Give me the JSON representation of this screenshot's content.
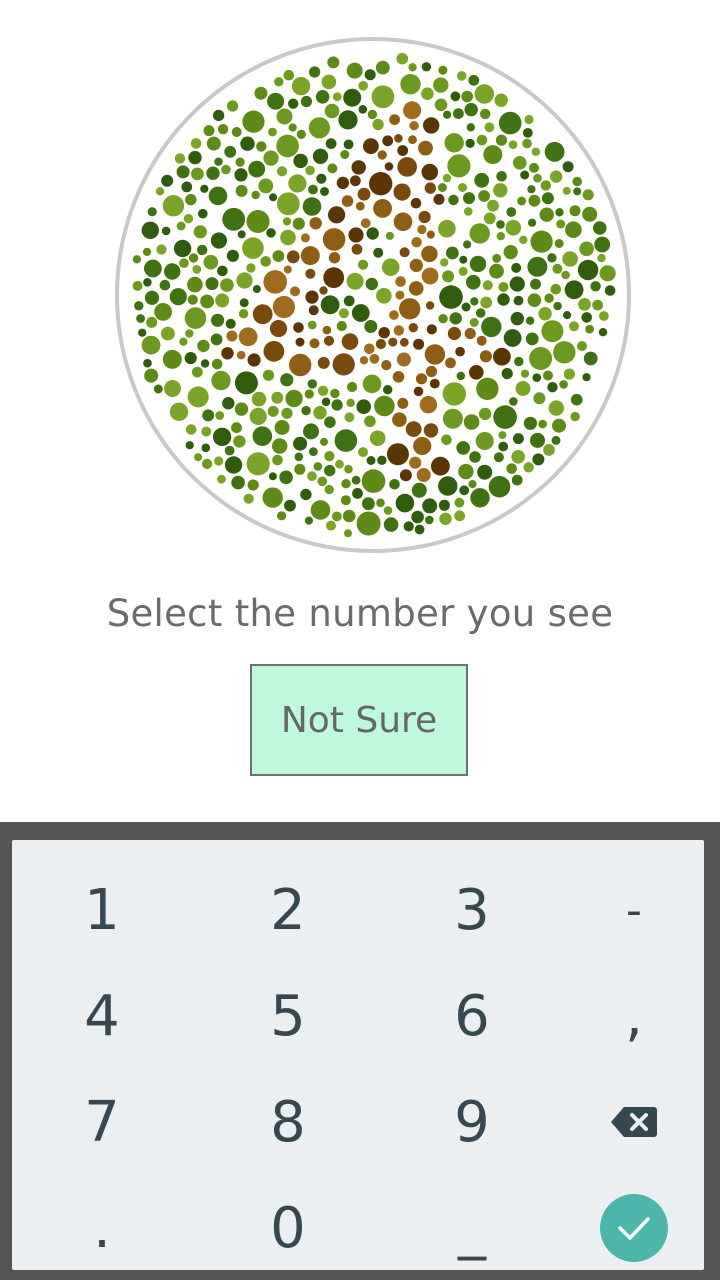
{
  "screen": {
    "prompt": "Select the number you see",
    "not_sure_label": "Not Sure"
  },
  "plate": {
    "name": "ishihara-plate",
    "background_dot_colors": [
      "#2f5c0d",
      "#3f7212",
      "#5e8a16",
      "#6c9a1e",
      "#7ba526"
    ],
    "figure_dot_colors": [
      "#5c3506",
      "#7a4a0c",
      "#8f5e12",
      "#a06b1c"
    ],
    "border_color": "#c9c9c9"
  },
  "keyboard": {
    "keys": [
      {
        "label": "1",
        "name": "key-1"
      },
      {
        "label": "2",
        "name": "key-2"
      },
      {
        "label": "3",
        "name": "key-3"
      },
      {
        "label": "-",
        "name": "key-minus"
      },
      {
        "label": "4",
        "name": "key-4"
      },
      {
        "label": "5",
        "name": "key-5"
      },
      {
        "label": "6",
        "name": "key-6"
      },
      {
        "label": ",",
        "name": "key-comma"
      },
      {
        "label": "7",
        "name": "key-7"
      },
      {
        "label": "8",
        "name": "key-8"
      },
      {
        "label": "9",
        "name": "key-9"
      },
      {
        "label": "",
        "name": "key-backspace",
        "icon": "backspace-icon"
      },
      {
        "label": ".",
        "name": "key-period"
      },
      {
        "label": "0",
        "name": "key-0"
      },
      {
        "label": "_",
        "name": "key-space"
      },
      {
        "label": "",
        "name": "key-enter",
        "icon": "check-icon"
      }
    ],
    "accent": "#4db6ac"
  }
}
